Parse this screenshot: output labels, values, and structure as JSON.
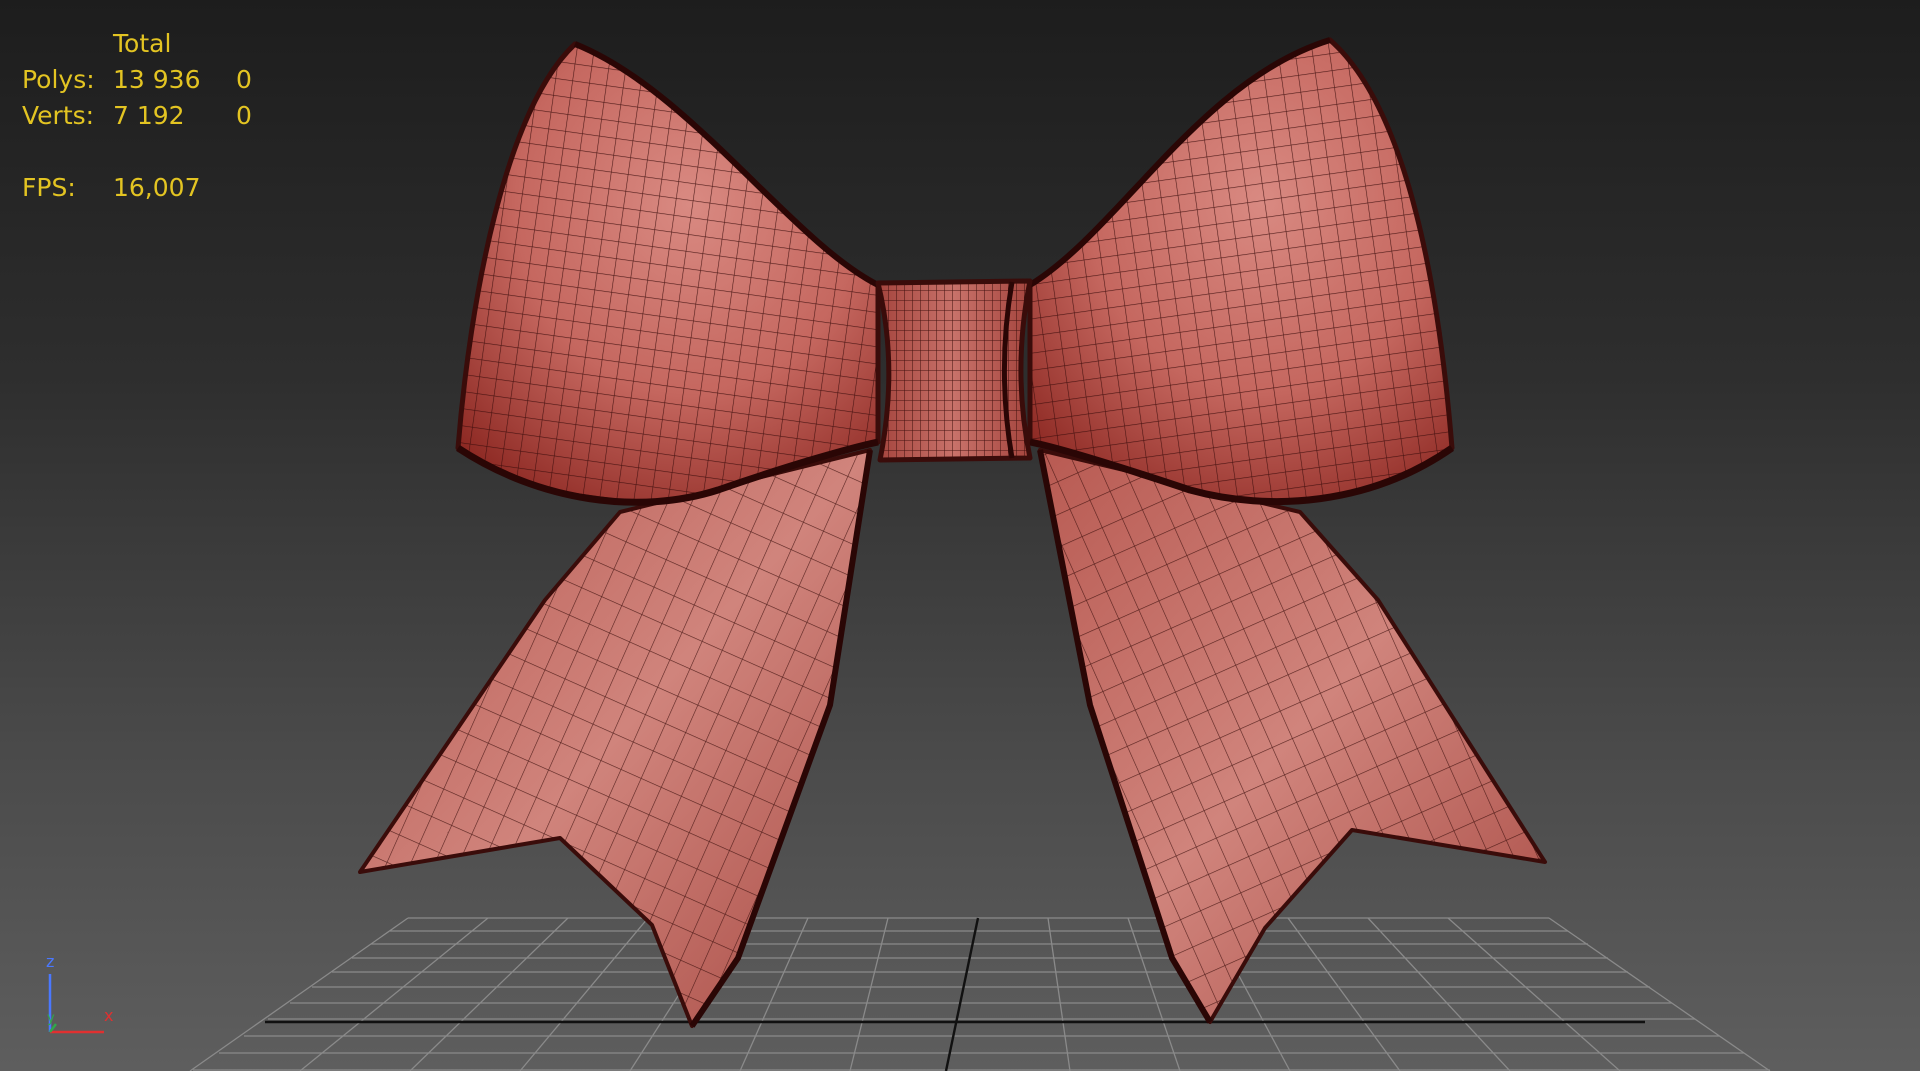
{
  "stats": {
    "header_total": "Total",
    "polys_label": "Polys:",
    "polys_total": "13 936",
    "polys_selected": "0",
    "verts_label": "Verts:",
    "verts_total": "7 192",
    "verts_selected": "0",
    "fps_label": "FPS:",
    "fps_value": "16,007"
  },
  "axis_gizmo": {
    "z_label": "z",
    "y_label": "y",
    "x_label": "x"
  },
  "colors": {
    "stats_text": "#e3c422",
    "ribbon": "#c5675f",
    "ribbon_dark": "#8e2a24",
    "wire": "#3a0c0a",
    "grid": "#8a8a8a",
    "axis_x": "#e03030",
    "axis_y": "#2fa84a",
    "axis_z": "#4a78ff"
  }
}
